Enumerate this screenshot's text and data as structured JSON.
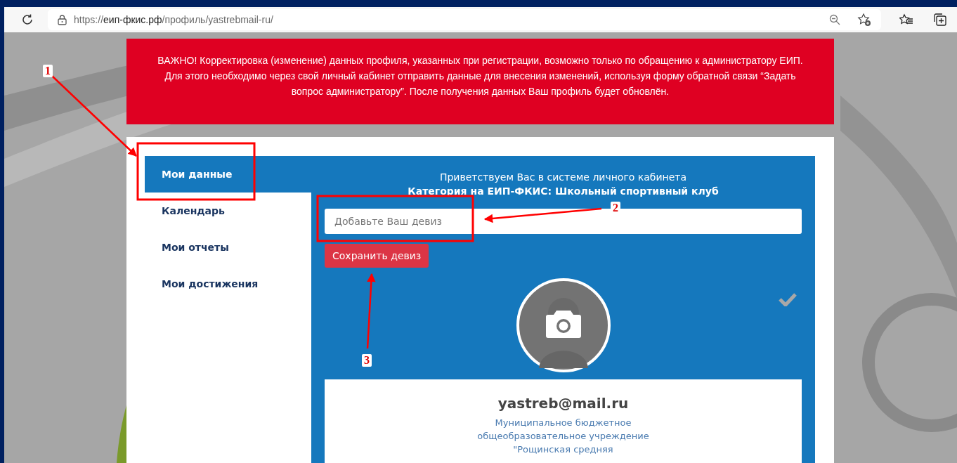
{
  "browser": {
    "url": {
      "scheme": "https://",
      "host": "еип-фкис.рф",
      "path": "/профиль/yastrebmail-ru/"
    }
  },
  "notice": {
    "text": "ВАЖНО! Корректировка (изменение) данных профиля, указанных при регистрации, возможно только по обращению к администратору ЕИП. Для этого необходимо через свой личный кабинет отправить данные для внесения изменений, используя форму обратной связи “Задать вопрос администратору”. После получения данных Ваш профиль будет обновлён."
  },
  "sidebar": {
    "items": [
      {
        "label": "Мои данные",
        "selected": true
      },
      {
        "label": "Календарь",
        "selected": false
      },
      {
        "label": "Мои отчеты",
        "selected": false
      },
      {
        "label": "Мои достижения",
        "selected": false
      }
    ]
  },
  "profile": {
    "greeting": "Приветствуем Вас в системе личного кабинета",
    "category": "Категория на ЕИП-ФКИС: Школьный спортивный клуб",
    "motto_field": {
      "placeholder": "Добавьте Ваш девиз"
    },
    "save_button": "Сохранить девиз",
    "email": "yastreb@mail.ru",
    "organization": [
      "Муниципальное бюджетное",
      "общеобразовательное учреждение",
      "\"Рощинская средняя"
    ]
  },
  "annotations": [
    {
      "label": "1"
    },
    {
      "label": "2"
    },
    {
      "label": "3"
    }
  ]
}
